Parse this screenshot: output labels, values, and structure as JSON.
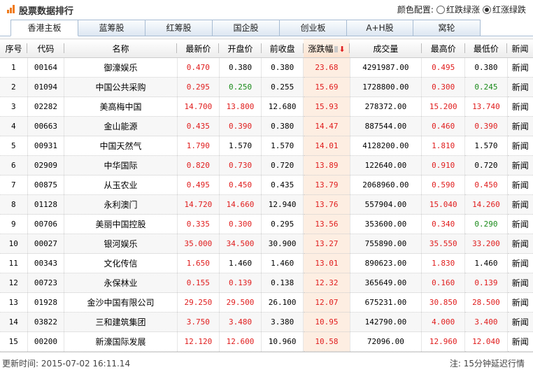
{
  "header": {
    "title": "股票数据排行",
    "color_config_label": "颜色配置:",
    "options": [
      {
        "label": "红跌绿涨",
        "checked": false
      },
      {
        "label": "红涨绿跌",
        "checked": true
      }
    ]
  },
  "tabs": [
    {
      "label": "香港主板",
      "active": true
    },
    {
      "label": "蓝筹股",
      "active": false
    },
    {
      "label": "红筹股",
      "active": false
    },
    {
      "label": "国企股",
      "active": false
    },
    {
      "label": "创业板",
      "active": false
    },
    {
      "label": "A+H股",
      "active": false
    },
    {
      "label": "窝轮",
      "active": false
    }
  ],
  "table": {
    "columns": [
      "序号",
      "代码",
      "名称",
      "最新价",
      "开盘价",
      "前收盘",
      "涨跌幅",
      "成交量",
      "最高价",
      "最低价",
      "新闻"
    ],
    "rows": [
      [
        "1",
        "00164",
        "御濠娱乐",
        "0.470",
        "0.380",
        "0.380",
        "23.68",
        "4291987.00",
        "0.495",
        "0.380",
        "新闻"
      ],
      [
        "2",
        "01094",
        "中国公共采购",
        "0.295",
        "0.250",
        "0.255",
        "15.69",
        "1728800.00",
        "0.300",
        "0.245",
        "新闻"
      ],
      [
        "3",
        "02282",
        "美高梅中国",
        "14.700",
        "13.800",
        "12.680",
        "15.93",
        "278372.00",
        "15.200",
        "13.740",
        "新闻"
      ],
      [
        "4",
        "00663",
        "金山能源",
        "0.435",
        "0.390",
        "0.380",
        "14.47",
        "887544.00",
        "0.460",
        "0.390",
        "新闻"
      ],
      [
        "5",
        "00931",
        "中国天然气",
        "1.790",
        "1.570",
        "1.570",
        "14.01",
        "4128200.00",
        "1.810",
        "1.570",
        "新闻"
      ],
      [
        "6",
        "02909",
        "中华国际",
        "0.820",
        "0.730",
        "0.720",
        "13.89",
        "122640.00",
        "0.910",
        "0.720",
        "新闻"
      ],
      [
        "7",
        "00875",
        "从玉农业",
        "0.495",
        "0.450",
        "0.435",
        "13.79",
        "2068960.00",
        "0.590",
        "0.450",
        "新闻"
      ],
      [
        "8",
        "01128",
        "永利澳门",
        "14.720",
        "14.660",
        "12.940",
        "13.76",
        "557904.00",
        "15.040",
        "14.260",
        "新闻"
      ],
      [
        "9",
        "00706",
        "美丽中国控股",
        "0.335",
        "0.300",
        "0.295",
        "13.56",
        "353600.00",
        "0.340",
        "0.290",
        "新闻"
      ],
      [
        "10",
        "00027",
        "银河娱乐",
        "35.000",
        "34.500",
        "30.900",
        "13.27",
        "755890.00",
        "35.550",
        "33.200",
        "新闻"
      ],
      [
        "11",
        "00343",
        "文化传信",
        "1.650",
        "1.460",
        "1.460",
        "13.01",
        "890623.00",
        "1.830",
        "1.460",
        "新闻"
      ],
      [
        "12",
        "00723",
        "永保林业",
        "0.155",
        "0.139",
        "0.138",
        "12.32",
        "365649.00",
        "0.160",
        "0.139",
        "新闻"
      ],
      [
        "13",
        "01928",
        "金沙中国有限公司",
        "29.250",
        "29.500",
        "26.100",
        "12.07",
        "675231.00",
        "30.850",
        "28.500",
        "新闻"
      ],
      [
        "14",
        "03822",
        "三和建筑集团",
        "3.750",
        "3.480",
        "3.380",
        "10.95",
        "142790.00",
        "4.000",
        "3.400",
        "新闻"
      ],
      [
        "15",
        "00200",
        "新濠国际发展",
        "12.120",
        "12.600",
        "10.960",
        "10.58",
        "72096.00",
        "12.960",
        "12.040",
        "新闻"
      ]
    ],
    "cell_colors": [
      [
        "",
        "",
        "",
        "red",
        "",
        "",
        "red",
        "",
        "red",
        "",
        ""
      ],
      [
        "",
        "",
        "",
        "red",
        "green",
        "",
        "red",
        "",
        "red",
        "green",
        ""
      ],
      [
        "",
        "",
        "",
        "red",
        "red",
        "",
        "red",
        "",
        "red",
        "red",
        ""
      ],
      [
        "",
        "",
        "",
        "red",
        "red",
        "",
        "red",
        "",
        "red",
        "red",
        ""
      ],
      [
        "",
        "",
        "",
        "red",
        "",
        "",
        "red",
        "",
        "red",
        "",
        ""
      ],
      [
        "",
        "",
        "",
        "red",
        "red",
        "",
        "red",
        "",
        "red",
        "",
        ""
      ],
      [
        "",
        "",
        "",
        "red",
        "red",
        "",
        "red",
        "",
        "red",
        "red",
        ""
      ],
      [
        "",
        "",
        "",
        "red",
        "red",
        "",
        "red",
        "",
        "red",
        "red",
        ""
      ],
      [
        "",
        "",
        "",
        "red",
        "red",
        "",
        "red",
        "",
        "red",
        "green",
        ""
      ],
      [
        "",
        "",
        "",
        "red",
        "red",
        "",
        "red",
        "",
        "red",
        "red",
        ""
      ],
      [
        "",
        "",
        "",
        "red",
        "",
        "",
        "red",
        "",
        "red",
        "",
        ""
      ],
      [
        "",
        "",
        "",
        "red",
        "red",
        "",
        "red",
        "",
        "red",
        "red",
        ""
      ],
      [
        "",
        "",
        "",
        "red",
        "red",
        "",
        "red",
        "",
        "red",
        "red",
        ""
      ],
      [
        "",
        "",
        "",
        "red",
        "red",
        "",
        "red",
        "",
        "red",
        "red",
        ""
      ],
      [
        "",
        "",
        "",
        "red",
        "red",
        "",
        "red",
        "",
        "red",
        "red",
        ""
      ]
    ]
  },
  "footer": {
    "update_time": "更新时间: 2015-07-02 16:11.14",
    "note": "注: 15分钟延迟行情"
  },
  "colors": {
    "up": "#e01c1c",
    "down": "#1a8a1a",
    "accent": "#f07a1a"
  }
}
